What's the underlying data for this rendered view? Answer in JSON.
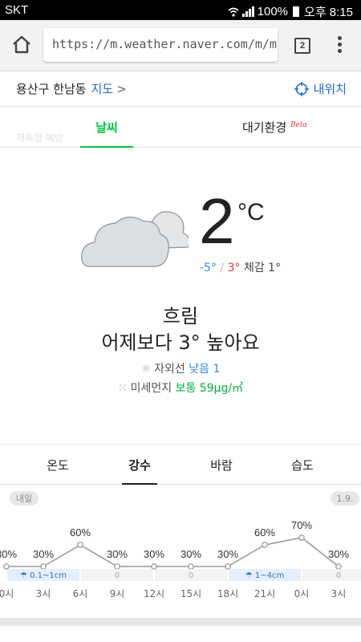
{
  "status_bar": {
    "carrier": "SKT",
    "battery": "100%",
    "time": "오후 8:15"
  },
  "browser": {
    "url": "https://m.weather.naver.com/m/m",
    "tab_count": "2"
  },
  "location": {
    "name": "용산구 한남동",
    "map_link": "지도",
    "chevron": ">",
    "my_location": "내위치"
  },
  "tabs": {
    "weather": "날씨",
    "air": "대기환경",
    "air_badge": "Beta"
  },
  "ghost_text": "재특정 예방",
  "current": {
    "temp": "2",
    "unit": "°C",
    "low": "-5°",
    "sep": "/",
    "high": "3°",
    "feels": "체감 1°",
    "condition": "흐림",
    "compare": "어제보다 3° 높아요",
    "uv_label": "자외선",
    "uv_value": "낮음 1",
    "dust_label": "미세먼지",
    "dust_value": "보통 59μg/㎥"
  },
  "sub_tabs": [
    "온도",
    "강수",
    "바람",
    "습도"
  ],
  "sub_tab_active": 1,
  "chart_data": {
    "type": "line",
    "day_markers": [
      {
        "label": "내일",
        "at_index": 0
      },
      {
        "label": "1.9.",
        "at_index": 9
      }
    ],
    "categories": [
      "0시",
      "3시",
      "6시",
      "9시",
      "12시",
      "15시",
      "18시",
      "21시",
      "0시",
      "3시"
    ],
    "series": [
      {
        "values": [
          30,
          30,
          60,
          30,
          30,
          30,
          30,
          60,
          70,
          30
        ]
      }
    ],
    "value_labels": [
      "30%",
      "30%",
      "60%",
      "30%",
      "30%",
      "30%",
      "30%",
      "60%",
      "70%",
      "30%"
    ],
    "amount_bands": [
      {
        "label": "0.1~1cm",
        "from": 0,
        "to": 2,
        "highlight": true
      },
      {
        "label": "0",
        "from": 2,
        "to": 4,
        "highlight": false
      },
      {
        "label": "0",
        "from": 4,
        "to": 6,
        "highlight": false
      },
      {
        "label": "1~4cm",
        "from": 6,
        "to": 8,
        "highlight": true
      },
      {
        "label": "0",
        "from": 8,
        "to": 10,
        "highlight": false
      }
    ],
    "ylim": [
      0,
      100
    ],
    "colors": {
      "line": "#999999",
      "highlight_band": "#e3efff",
      "band": "#f3f3f3"
    }
  }
}
